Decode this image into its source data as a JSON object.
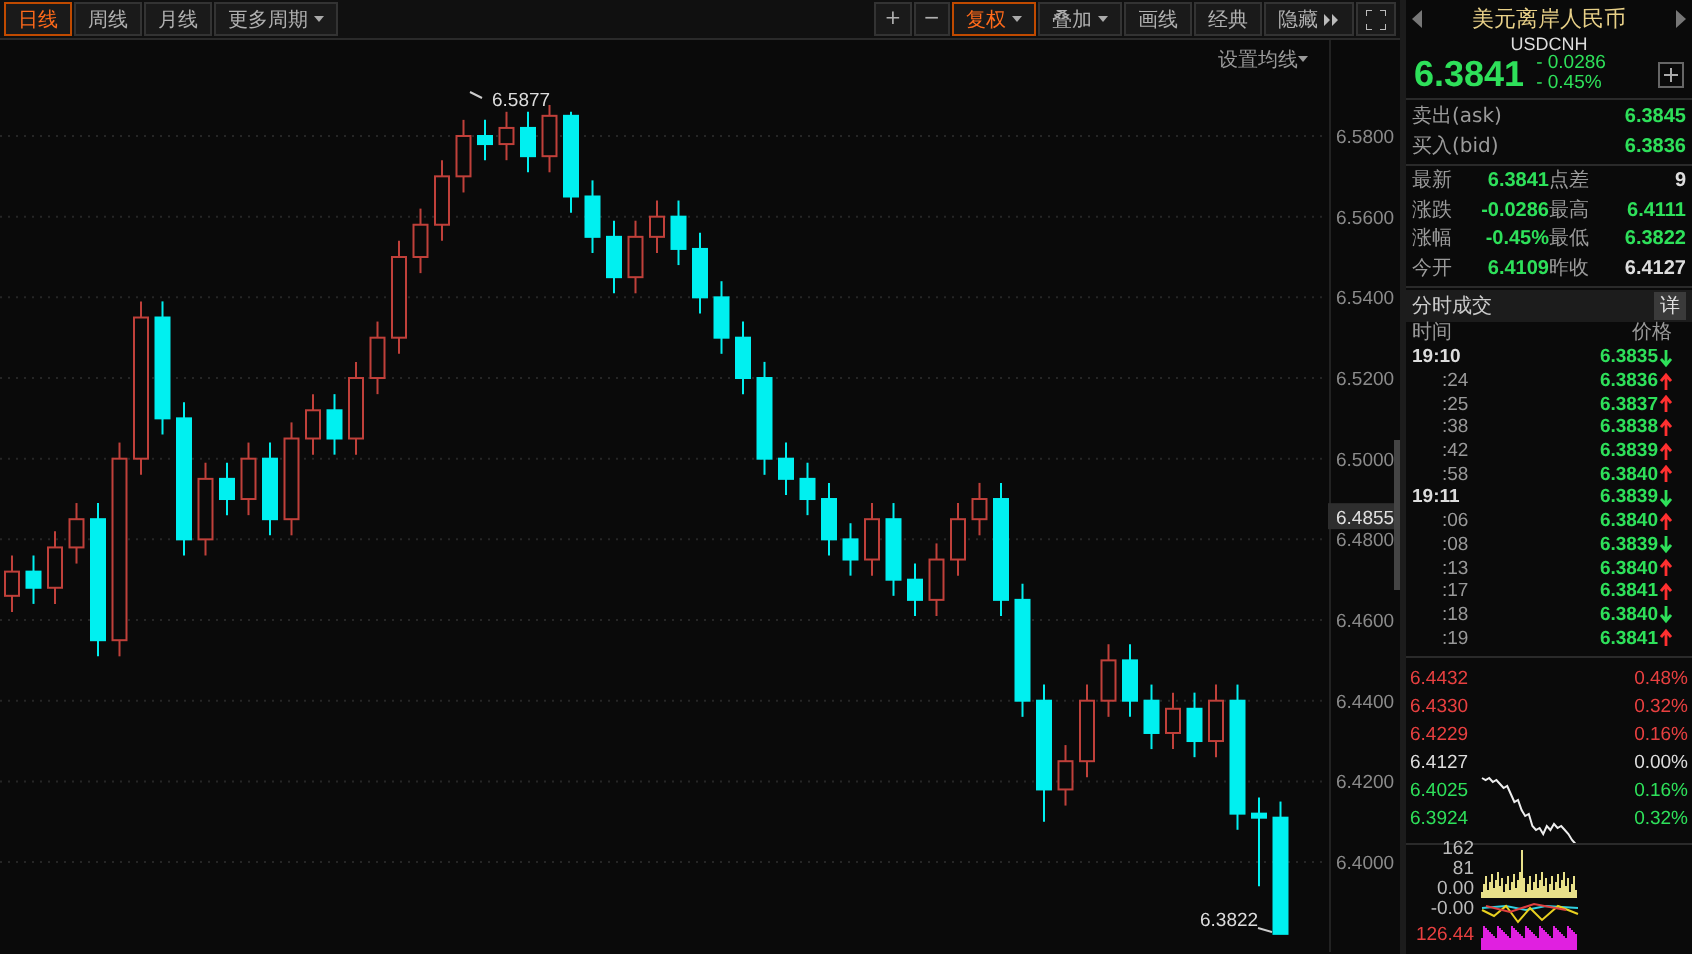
{
  "toolbar": {
    "period_tabs": [
      {
        "label": "日线",
        "selected": true,
        "dropdown": false
      },
      {
        "label": "周线",
        "selected": false,
        "dropdown": false
      },
      {
        "label": "月线",
        "selected": false,
        "dropdown": false
      },
      {
        "label": "更多周期",
        "selected": false,
        "dropdown": true
      }
    ],
    "tools": [
      {
        "label": "+",
        "selected": false,
        "dropdown": false,
        "kind": "plain"
      },
      {
        "label": "−",
        "selected": false,
        "dropdown": false,
        "kind": "plain"
      },
      {
        "label": "复权",
        "selected": true,
        "dropdown": true,
        "kind": "plain"
      },
      {
        "label": "叠加",
        "selected": false,
        "dropdown": true,
        "kind": "plain"
      },
      {
        "label": "画线",
        "selected": false,
        "dropdown": false,
        "kind": "plain"
      },
      {
        "label": "经典",
        "selected": false,
        "dropdown": false,
        "kind": "plain"
      },
      {
        "label": "隐藏",
        "selected": false,
        "dropdown": false,
        "kind": "collapse"
      }
    ]
  },
  "chart": {
    "ma_setting": "设置均线",
    "current_price": "6.4855",
    "high_marker": "6.5877",
    "low_marker": "6.3822",
    "chart_data": {
      "type": "candlestick",
      "grid": true,
      "ylim": [
        6.3777,
        6.6038
      ],
      "yticks": [
        {
          "value": 6.58,
          "label": "6.5800"
        },
        {
          "value": 6.56,
          "label": "6.5600"
        },
        {
          "value": 6.54,
          "label": "6.5400"
        },
        {
          "value": 6.52,
          "label": "6.5200"
        },
        {
          "value": 6.5,
          "label": "6.5000"
        },
        {
          "value": 6.48,
          "label": "6.4800"
        },
        {
          "value": 6.46,
          "label": "6.4600"
        },
        {
          "value": 6.44,
          "label": "6.4400"
        },
        {
          "value": 6.42,
          "label": "6.4200"
        },
        {
          "value": 6.4,
          "label": "6.4000"
        }
      ],
      "ohlc": [
        [
          6.466,
          6.476,
          6.462,
          6.472
        ],
        [
          6.472,
          6.476,
          6.464,
          6.468
        ],
        [
          6.468,
          6.482,
          6.464,
          6.478
        ],
        [
          6.478,
          6.489,
          6.474,
          6.485
        ],
        [
          6.485,
          6.489,
          6.451,
          6.455
        ],
        [
          6.455,
          6.504,
          6.451,
          6.5
        ],
        [
          6.5,
          6.539,
          6.496,
          6.535
        ],
        [
          6.535,
          6.539,
          6.506,
          6.51
        ],
        [
          6.51,
          6.514,
          6.476,
          6.48
        ],
        [
          6.48,
          6.499,
          6.476,
          6.495
        ],
        [
          6.495,
          6.499,
          6.486,
          6.49
        ],
        [
          6.49,
          6.504,
          6.486,
          6.5
        ],
        [
          6.5,
          6.504,
          6.481,
          6.485
        ],
        [
          6.485,
          6.509,
          6.481,
          6.505
        ],
        [
          6.505,
          6.516,
          6.501,
          6.512
        ],
        [
          6.512,
          6.516,
          6.501,
          6.505
        ],
        [
          6.505,
          6.524,
          6.501,
          6.52
        ],
        [
          6.52,
          6.534,
          6.516,
          6.53
        ],
        [
          6.53,
          6.554,
          6.526,
          6.55
        ],
        [
          6.55,
          6.562,
          6.546,
          6.558
        ],
        [
          6.558,
          6.574,
          6.554,
          6.57
        ],
        [
          6.57,
          6.584,
          6.566,
          6.58
        ],
        [
          6.58,
          6.584,
          6.574,
          6.578
        ],
        [
          6.578,
          6.586,
          6.574,
          6.582
        ],
        [
          6.582,
          6.586,
          6.571,
          6.575
        ],
        [
          6.575,
          6.5877,
          6.571,
          6.585
        ],
        [
          6.585,
          6.586,
          6.561,
          6.565
        ],
        [
          6.565,
          6.569,
          6.551,
          6.555
        ],
        [
          6.555,
          6.559,
          6.541,
          6.545
        ],
        [
          6.545,
          6.559,
          6.541,
          6.555
        ],
        [
          6.555,
          6.564,
          6.551,
          6.56
        ],
        [
          6.56,
          6.564,
          6.548,
          6.552
        ],
        [
          6.552,
          6.556,
          6.536,
          6.54
        ],
        [
          6.54,
          6.544,
          6.526,
          6.53
        ],
        [
          6.53,
          6.534,
          6.516,
          6.52
        ],
        [
          6.52,
          6.524,
          6.496,
          6.5
        ],
        [
          6.5,
          6.504,
          6.491,
          6.495
        ],
        [
          6.495,
          6.499,
          6.486,
          6.49
        ],
        [
          6.49,
          6.494,
          6.476,
          6.48
        ],
        [
          6.48,
          6.484,
          6.471,
          6.475
        ],
        [
          6.475,
          6.489,
          6.471,
          6.485
        ],
        [
          6.485,
          6.489,
          6.466,
          6.47
        ],
        [
          6.47,
          6.474,
          6.461,
          6.465
        ],
        [
          6.465,
          6.479,
          6.461,
          6.475
        ],
        [
          6.475,
          6.489,
          6.471,
          6.485
        ],
        [
          6.485,
          6.494,
          6.481,
          6.49
        ],
        [
          6.49,
          6.494,
          6.461,
          6.465
        ],
        [
          6.465,
          6.469,
          6.436,
          6.44
        ],
        [
          6.44,
          6.444,
          6.41,
          6.418
        ],
        [
          6.418,
          6.429,
          6.414,
          6.425
        ],
        [
          6.425,
          6.444,
          6.421,
          6.44
        ],
        [
          6.44,
          6.454,
          6.436,
          6.45
        ],
        [
          6.45,
          6.454,
          6.436,
          6.44
        ],
        [
          6.44,
          6.444,
          6.428,
          6.432
        ],
        [
          6.432,
          6.442,
          6.428,
          6.438
        ],
        [
          6.438,
          6.442,
          6.426,
          6.43
        ],
        [
          6.43,
          6.444,
          6.426,
          6.44
        ],
        [
          6.44,
          6.444,
          6.408,
          6.412
        ],
        [
          6.412,
          6.416,
          6.394,
          6.411
        ],
        [
          6.411,
          6.415,
          6.3822,
          6.3822
        ]
      ]
    }
  },
  "quote": {
    "title": "美元离岸人民币",
    "symbol": "USDCNH",
    "price": "6.3841",
    "change": "- 0.0286",
    "change_pct": "- 0.45%"
  },
  "bid_ask": [
    {
      "label": "卖出(ask)",
      "value": "6.3845"
    },
    {
      "label": "买入(bid)",
      "value": "6.3836"
    }
  ],
  "stats": [
    {
      "label": "最新",
      "value": "6.3841",
      "color": "#2ee05a"
    },
    {
      "label": "点差",
      "value": "9",
      "color": "#dddddd"
    },
    {
      "label": "涨跌",
      "value": "-0.0286",
      "color": "#2ee05a"
    },
    {
      "label": "最高",
      "value": "6.4111",
      "color": "#2ee05a"
    },
    {
      "label": "涨幅",
      "value": "-0.45%",
      "color": "#2ee05a"
    },
    {
      "label": "最低",
      "value": "6.3822",
      "color": "#2ee05a"
    },
    {
      "label": "今开",
      "value": "6.4109",
      "color": "#2ee05a"
    },
    {
      "label": "昨收",
      "value": "6.4127",
      "color": "#dddddd"
    }
  ],
  "trades": {
    "title": "分时成交",
    "detail_button": "详",
    "columns": [
      "时间",
      "价格"
    ],
    "rows": [
      {
        "time": "19:10",
        "price": "6.3835",
        "rising": false,
        "kind": "minute"
      },
      {
        "time": ":24",
        "price": "6.3836",
        "rising": true,
        "kind": "second"
      },
      {
        "time": ":25",
        "price": "6.3837",
        "rising": true,
        "kind": "second"
      },
      {
        "time": ":38",
        "price": "6.3838",
        "rising": true,
        "kind": "second"
      },
      {
        "time": ":42",
        "price": "6.3839",
        "rising": true,
        "kind": "second"
      },
      {
        "time": ":58",
        "price": "6.3840",
        "rising": true,
        "kind": "second"
      },
      {
        "time": "19:11",
        "price": "6.3839",
        "rising": false,
        "kind": "minute"
      },
      {
        "time": ":06",
        "price": "6.3840",
        "rising": true,
        "kind": "second"
      },
      {
        "time": ":08",
        "price": "6.3839",
        "rising": false,
        "kind": "second"
      },
      {
        "time": ":13",
        "price": "6.3840",
        "rising": true,
        "kind": "second"
      },
      {
        "time": ":17",
        "price": "6.3841",
        "rising": true,
        "kind": "second"
      },
      {
        "time": ":18",
        "price": "6.3840",
        "rising": false,
        "kind": "second"
      },
      {
        "time": ":19",
        "price": "6.3841",
        "rising": true,
        "kind": "second"
      }
    ]
  },
  "mini_chart": {
    "price_labels": [
      {
        "value": "6.4432",
        "color": "#e84040"
      },
      {
        "value": "6.4330",
        "color": "#e84040"
      },
      {
        "value": "6.4229",
        "color": "#e84040"
      },
      {
        "value": "6.4127",
        "color": "#dddddd"
      },
      {
        "value": "6.4025",
        "color": "#2ee05a"
      },
      {
        "value": "6.3924",
        "color": "#2ee05a"
      }
    ],
    "percent_labels": [
      {
        "value": "0.48%",
        "color": "#e84040"
      },
      {
        "value": "0.32%",
        "color": "#e84040"
      },
      {
        "value": "0.16%",
        "color": "#e84040"
      },
      {
        "value": "0.00%",
        "color": "#dddddd"
      },
      {
        "value": "0.16%",
        "color": "#2ee05a"
      },
      {
        "value": "0.32%",
        "color": "#2ee05a"
      }
    ],
    "volume_labels": [
      {
        "value": "162",
        "color": "#bbbbbb"
      },
      {
        "value": "81",
        "color": "#bbbbbb"
      },
      {
        "value": "0.00",
        "color": "#bbbbbb"
      },
      {
        "value": "-0.00",
        "color": "#bbbbbb"
      },
      {
        "value": "126.44",
        "color": "#e84040"
      }
    ]
  }
}
